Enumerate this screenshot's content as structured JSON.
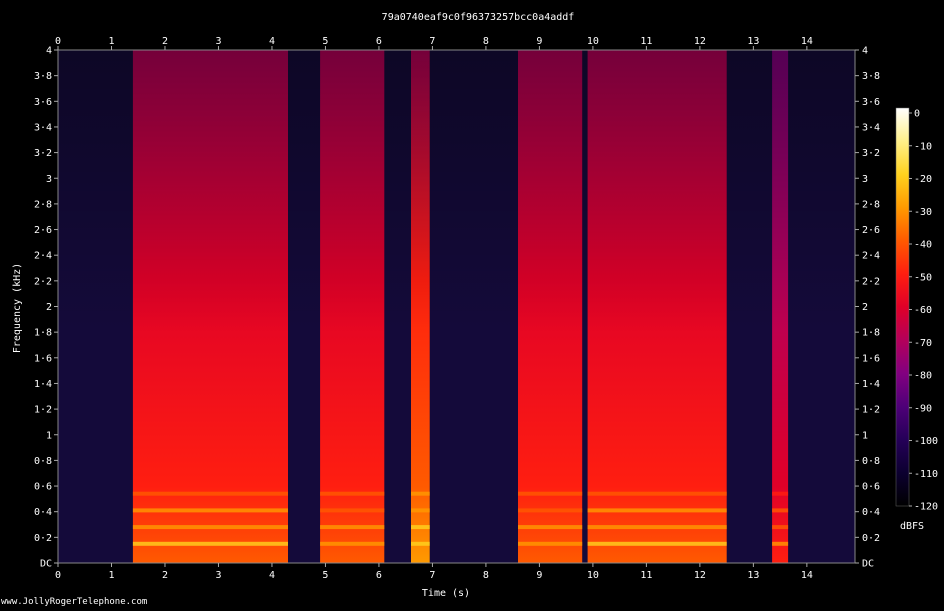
{
  "title": "79a0740eaf9c0f96373257bcc0a4addf",
  "footer": "www.JollyRogerTelephone.com",
  "colorbar": {
    "label": "dBFS",
    "ticks": [
      0,
      -10,
      -20,
      -30,
      -40,
      -50,
      -60,
      -70,
      -80,
      -90,
      -100,
      -110,
      -120
    ],
    "colors": [
      "#ffffff",
      "#fff08a",
      "#ffd21e",
      "#ff9a00",
      "#ff5a00",
      "#ff1e10",
      "#e00028",
      "#b4005a",
      "#820080",
      "#4e0078",
      "#250058",
      "#0c0030",
      "#000000"
    ]
  },
  "chart_data": {
    "type": "heatmap",
    "title": "79a0740eaf9c0f96373257bcc0a4addf",
    "xlabel": "Time (s)",
    "ylabel": "Frequency (kHz)",
    "xlim": [
      0,
      14.9
    ],
    "ylim": [
      0,
      4
    ],
    "x_ticks": [
      "0",
      "1",
      "2",
      "3",
      "4",
      "5",
      "6",
      "7",
      "8",
      "9",
      "10",
      "11",
      "12",
      "13",
      "14"
    ],
    "y_ticks": [
      "DC",
      "0·2",
      "0·4",
      "0·6",
      "0·8",
      "1",
      "1·2",
      "1·4",
      "1·6",
      "1·8",
      "2",
      "2·2",
      "2·4",
      "2·6",
      "2·8",
      "3",
      "3·2",
      "3·4",
      "3·6",
      "3·8",
      "4"
    ],
    "value_unit": "dBFS",
    "background_level_dbfs": -105,
    "speech_segments": [
      {
        "start": 1.4,
        "end": 4.3,
        "level_dbfs": -45
      },
      {
        "start": 4.9,
        "end": 6.1,
        "level_dbfs": -48
      },
      {
        "start": 6.6,
        "end": 6.95,
        "level_dbfs": -40
      },
      {
        "start": 8.6,
        "end": 9.8,
        "level_dbfs": -48
      },
      {
        "start": 9.9,
        "end": 12.5,
        "level_dbfs": -45
      },
      {
        "start": 13.35,
        "end": 13.65,
        "level_dbfs": -55
      }
    ]
  }
}
